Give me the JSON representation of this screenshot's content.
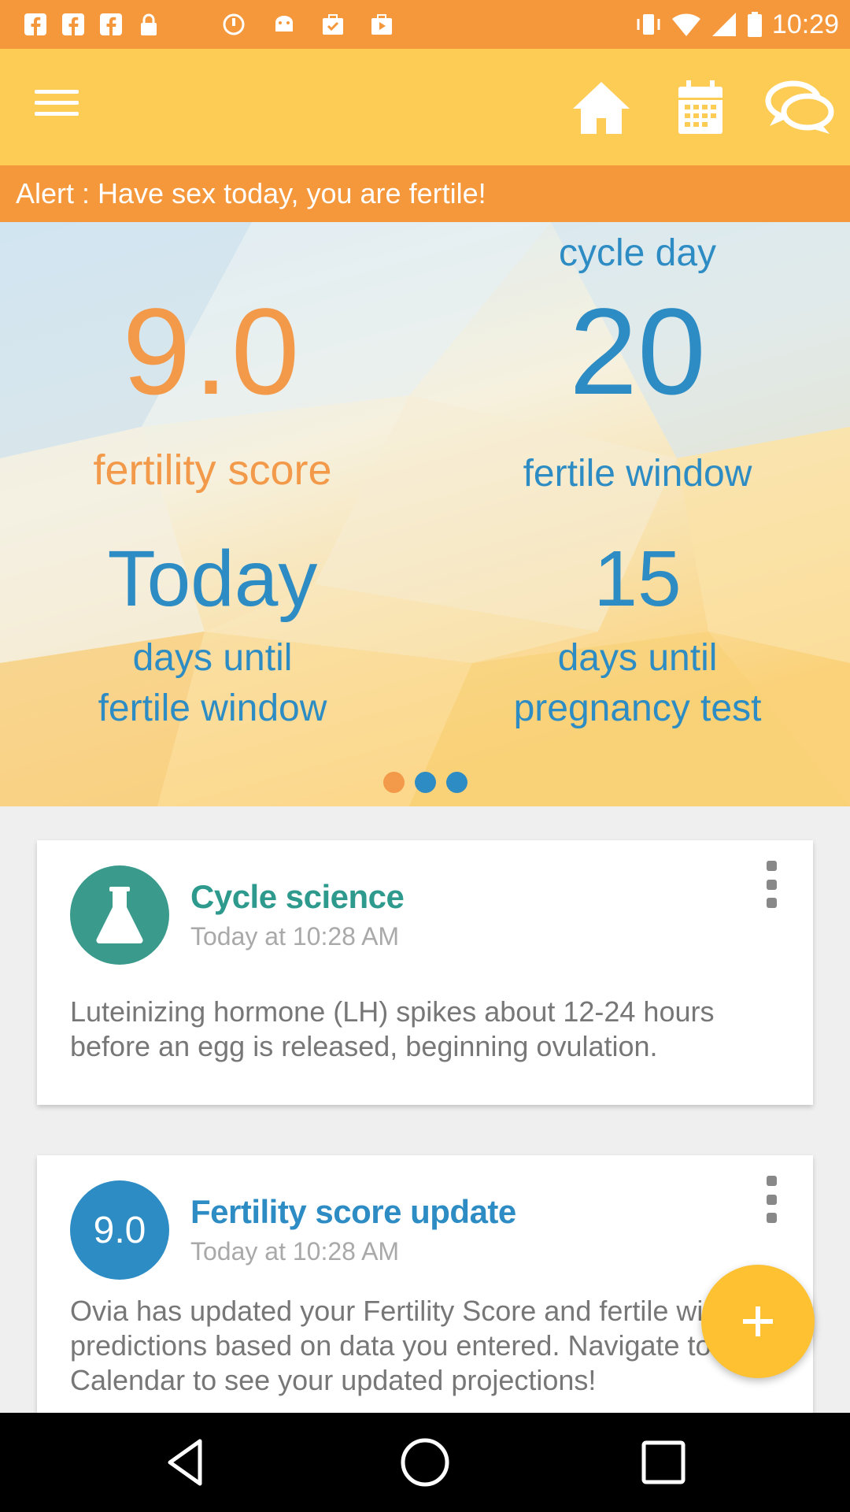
{
  "status_bar": {
    "time": "10:29",
    "left_icons": [
      "facebook-icon",
      "facebook-icon",
      "facebook-icon",
      "lock-icon",
      "sync-icon",
      "android-icon",
      "briefcase-check-icon",
      "briefcase-play-icon"
    ],
    "right_icons": [
      "vibrate-icon",
      "wifi-icon",
      "signal-icon",
      "battery-icon"
    ]
  },
  "app_bar": {
    "icons": [
      "menu-icon",
      "home-icon",
      "calendar-icon",
      "chat-icon"
    ]
  },
  "alert": {
    "text": "Alert : Have sex today, you are fertile!"
  },
  "hero": {
    "fertility_score_value": "9.0",
    "fertility_score_label": "fertility score",
    "cycle_day_label": "cycle day",
    "cycle_day_value": "20",
    "fertile_window_label": "fertile window",
    "days_until_window_value": "Today",
    "days_until_window_line1": "days until",
    "days_until_window_line2": "fertile window",
    "days_until_test_value": "15",
    "days_until_test_line1": "days until",
    "days_until_test_line2": "pregnancy test",
    "page_dots": 3,
    "active_dot": 0
  },
  "cards": [
    {
      "title": "Cycle science",
      "time": "Today at 10:28 AM",
      "body": "Luteinizing hormone (LH) spikes about 12-24 hours before an egg is released, beginning ovulation.",
      "avatar_icon": "flask-icon",
      "avatar_color": "#3a9a8c",
      "title_color": "#2d9a8d"
    },
    {
      "title": "Fertility score update",
      "time": "Today at 10:28 AM",
      "body": "Ovia has updated your Fertility Score and fertile window predictions based on data you entered. Navigate to your Calendar to see your updated projections!",
      "avatar_text": "9.0",
      "avatar_color": "#2d8cc3",
      "title_color": "#2d8cc3"
    }
  ],
  "fab": {
    "icon": "plus-icon"
  },
  "colors": {
    "status_bar": "#f5973b",
    "app_bar": "#fdcc55",
    "alert_bar": "#f5973b",
    "accent_orange": "#f3994a",
    "accent_blue": "#2d8cc3",
    "fab": "#fdc131"
  },
  "nav_bar": {
    "icons": [
      "back-icon",
      "home-circle-icon",
      "recents-icon"
    ]
  }
}
